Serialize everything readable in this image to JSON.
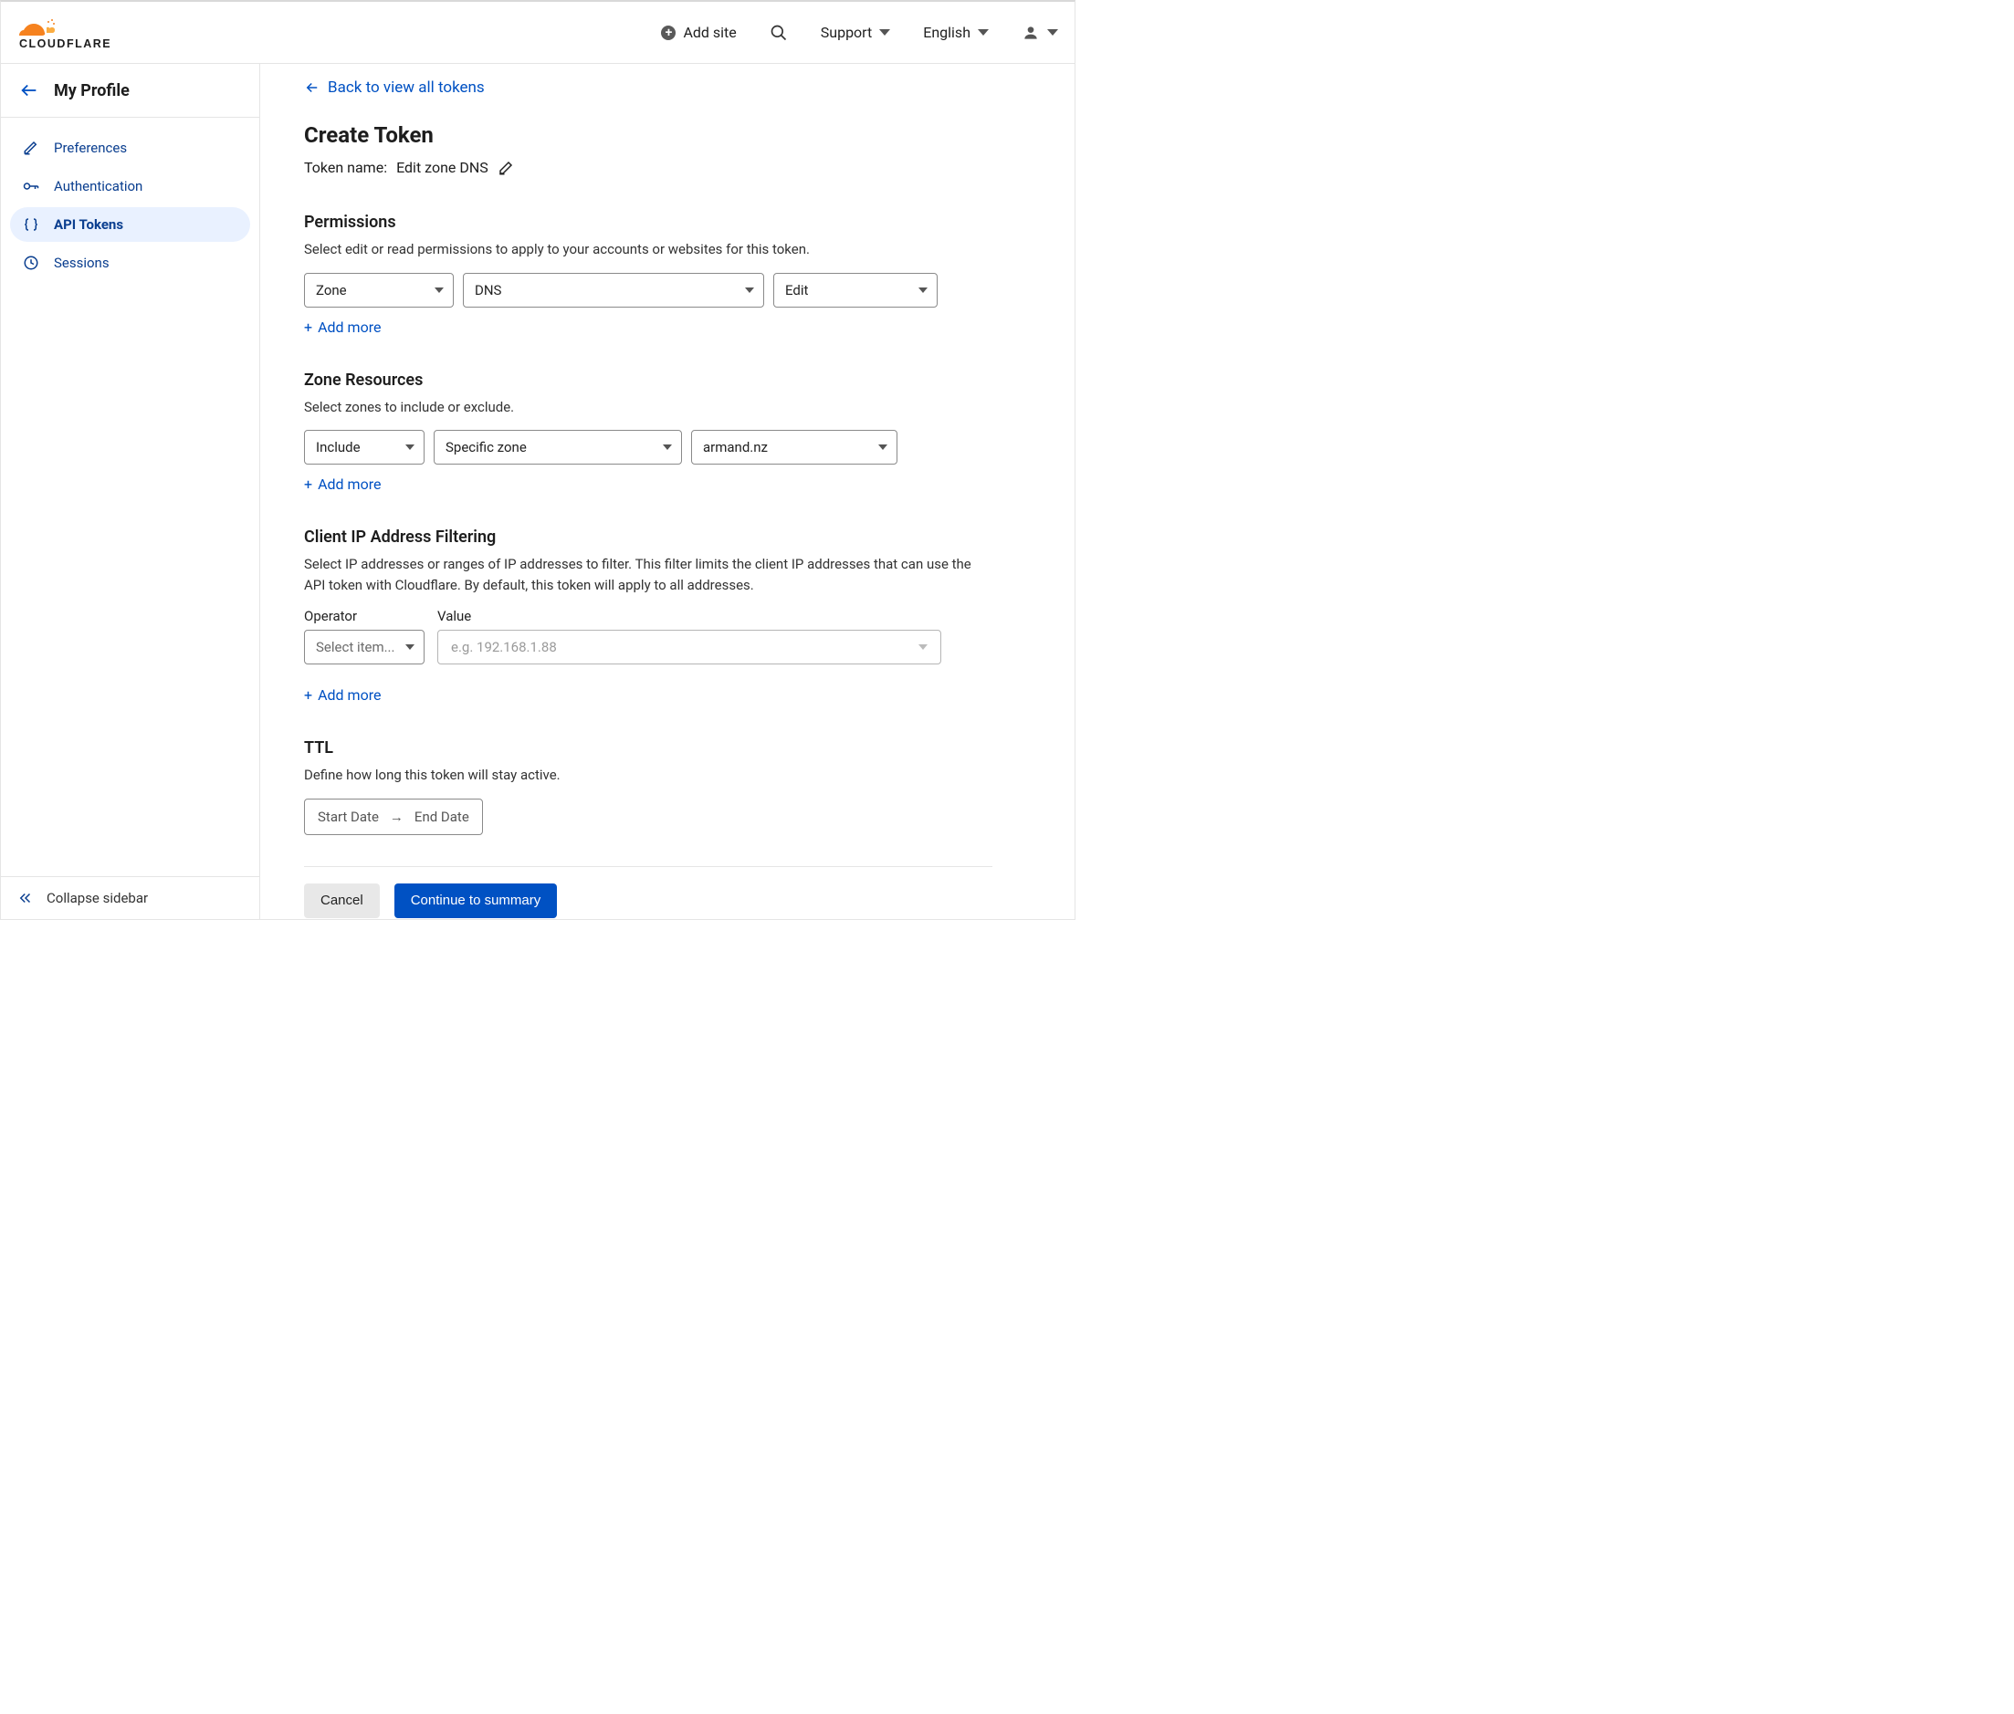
{
  "header": {
    "add_site": "Add site",
    "support": "Support",
    "language": "English"
  },
  "sidebar": {
    "title": "My Profile",
    "items": [
      {
        "label": "Preferences"
      },
      {
        "label": "Authentication"
      },
      {
        "label": "API Tokens"
      },
      {
        "label": "Sessions"
      }
    ],
    "collapse": "Collapse sidebar"
  },
  "main": {
    "back_link": "Back to view all tokens",
    "page_title": "Create Token",
    "token_name_label": "Token name:",
    "token_name_value": "Edit zone DNS",
    "permissions": {
      "heading": "Permissions",
      "desc": "Select edit or read permissions to apply to your accounts or websites for this token.",
      "row": {
        "scope": "Zone",
        "resource": "DNS",
        "level": "Edit"
      },
      "add_more": "Add more"
    },
    "zone_resources": {
      "heading": "Zone Resources",
      "desc": "Select zones to include or exclude.",
      "row": {
        "mode": "Include",
        "selector": "Specific zone",
        "zone": "armand.nz"
      },
      "add_more": "Add more"
    },
    "ip_filter": {
      "heading": "Client IP Address Filtering",
      "desc": "Select IP addresses or ranges of IP addresses to filter. This filter limits the client IP addresses that can use the API token with Cloudflare. By default, this token will apply to all addresses.",
      "operator_label": "Operator",
      "operator_placeholder": "Select item...",
      "value_label": "Value",
      "value_placeholder": "e.g. 192.168.1.88",
      "add_more": "Add more"
    },
    "ttl": {
      "heading": "TTL",
      "desc": "Define how long this token will stay active.",
      "start": "Start Date",
      "end": "End Date"
    },
    "footer": {
      "cancel": "Cancel",
      "continue": "Continue to summary"
    }
  }
}
